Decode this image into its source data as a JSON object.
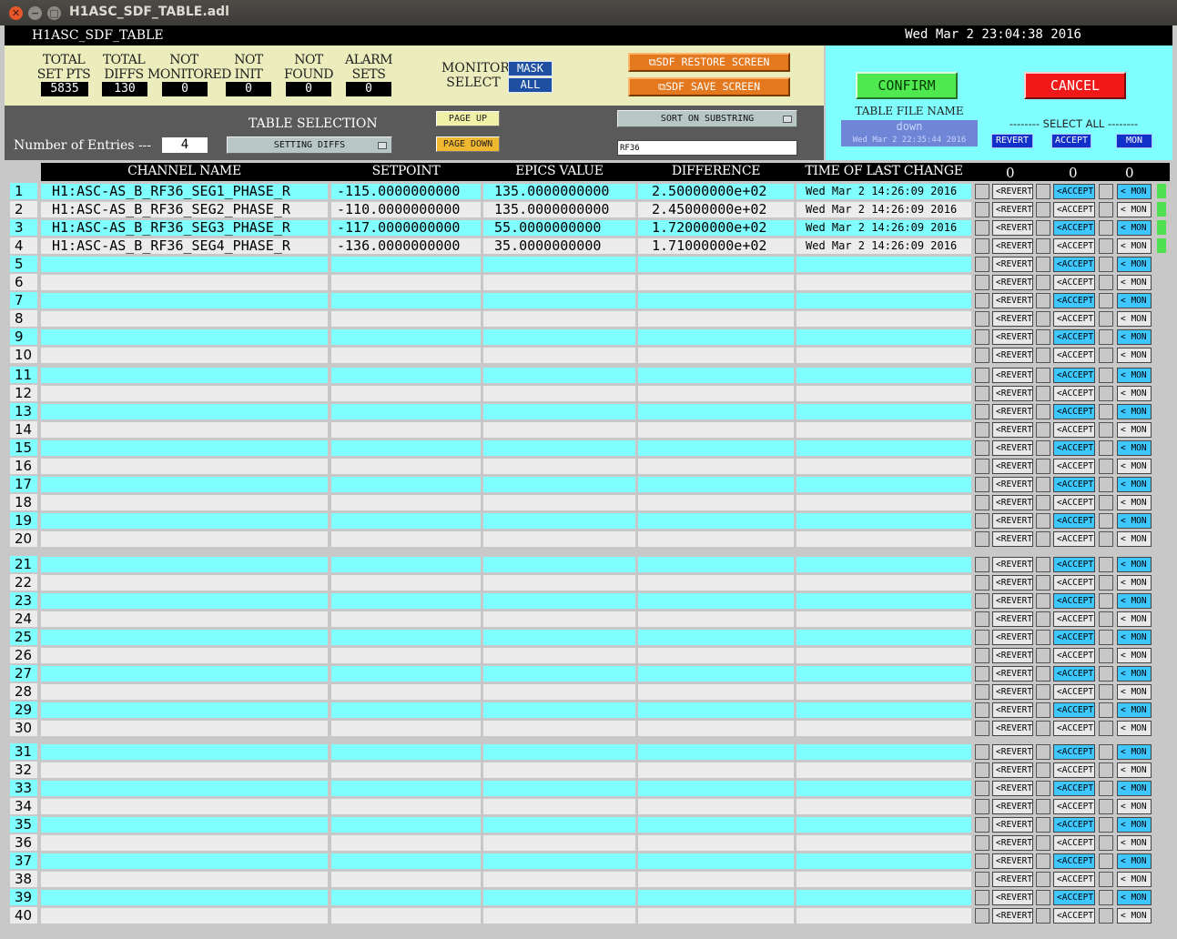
{
  "window": {
    "title": "H1ASC_SDF_TABLE.adl",
    "close": "✕",
    "minimize": "−",
    "maximize": "□"
  },
  "header": {
    "screen_title": "H1ASC_SDF_TABLE",
    "datetime": "Wed Mar  2 23:04:38 2016"
  },
  "summary": {
    "stats": [
      {
        "label1": "TOTAL",
        "label2": "SET PTS",
        "value": "5835"
      },
      {
        "label1": "TOTAL",
        "label2": "DIFFS",
        "value": "130"
      },
      {
        "label1": "NOT",
        "label2": "MONITORED",
        "value": "0"
      },
      {
        "label1": "NOT",
        "label2": "INIT",
        "value": "0"
      },
      {
        "label1": "NOT",
        "label2": "FOUND",
        "value": "0"
      },
      {
        "label1": "ALARM",
        "label2": "SETS",
        "value": "0"
      }
    ],
    "monitor_label1": "MONITOR",
    "monitor_label2": "SELECT",
    "mask_label": "MASK",
    "all_label": "ALL",
    "restore_label": "⧉SDF RESTORE SCREEN",
    "save_label": "⧉SDF SAVE SCREEN"
  },
  "confirm_panel": {
    "confirm_label": "CONFIRM",
    "cancel_label": "CANCEL",
    "table_file_label": "TABLE FILE NAME",
    "table_file_value": "down",
    "table_file_time": "Wed Mar  2 22:35:44 2016",
    "select_all_label": "-------- SELECT ALL --------",
    "revert_all": "REVERT",
    "accept_all": "ACCEPT",
    "mon_all": "MON"
  },
  "controls": {
    "table_selection_label": "TABLE SELECTION",
    "table_selection_value": "SETTING DIFFS",
    "entries_label": "Number of Entries ---",
    "entries_value": "4",
    "page_up": "PAGE UP",
    "page_down": "PAGE DOWN",
    "sort_label": "SORT ON SUBSTRING",
    "substring_value": "RF36"
  },
  "columns": {
    "channel": "CHANNEL NAME",
    "setpoint": "SETPOINT",
    "epics": "EPICS VALUE",
    "difference": "DIFFERENCE",
    "time": "TIME OF LAST CHANGE",
    "revert_count": "0",
    "accept_count": "0",
    "mon_count": "0"
  },
  "rows": [
    {
      "channel": "H1:ASC-AS_B_RF36_SEG1_PHASE_R",
      "setpoint": "-115.0000000000",
      "epics": "135.0000000000",
      "difference": "2.50000000e+02",
      "time": "Wed Mar  2 14:26:09 2016"
    },
    {
      "channel": "H1:ASC-AS_B_RF36_SEG2_PHASE_R",
      "setpoint": "-110.0000000000",
      "epics": "135.0000000000",
      "difference": "2.45000000e+02",
      "time": "Wed Mar  2 14:26:09 2016"
    },
    {
      "channel": "H1:ASC-AS_B_RF36_SEG3_PHASE_R",
      "setpoint": "-117.0000000000",
      "epics": "55.0000000000",
      "difference": "1.72000000e+02",
      "time": "Wed Mar  2 14:26:09 2016"
    },
    {
      "channel": "H1:ASC-AS_B_RF36_SEG4_PHASE_R",
      "setpoint": "-136.0000000000",
      "epics": "35.0000000000",
      "difference": "1.71000000e+02",
      "time": "Wed Mar  2 14:26:09 2016"
    }
  ],
  "row_buttons": {
    "revert": "<REVERT",
    "accept": "<ACCEPT",
    "mon": "< MON"
  },
  "colors": {
    "cyan": "#80ffff",
    "light": "#ececec",
    "accent_blue": "#1f4fa0",
    "led_green": "#4ee04e"
  }
}
